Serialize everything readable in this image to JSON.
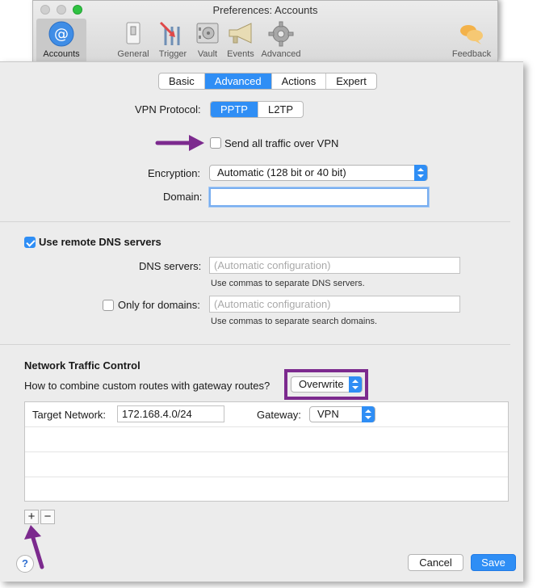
{
  "window": {
    "title": "Preferences: Accounts",
    "toolbar": [
      {
        "label": "Accounts",
        "icon": "at-sign-icon"
      },
      {
        "label": "General",
        "icon": "switch-icon"
      },
      {
        "label": "Trigger",
        "icon": "trigger-icon"
      },
      {
        "label": "Vault",
        "icon": "vault-icon"
      },
      {
        "label": "Events",
        "icon": "megaphone-icon"
      },
      {
        "label": "Advanced",
        "icon": "gear-icon"
      },
      {
        "label": "Feedback",
        "icon": "chat-bubbles-icon"
      }
    ]
  },
  "tabs": [
    "Basic",
    "Advanced",
    "Actions",
    "Expert"
  ],
  "active_tab": "Advanced",
  "vpn": {
    "protocol_label": "VPN Protocol:",
    "protocols": [
      "PPTP",
      "L2TP"
    ],
    "active_protocol": "PPTP",
    "send_all_traffic_label": "Send all traffic over VPN",
    "send_all_traffic_checked": false,
    "encryption_label": "Encryption:",
    "encryption_value": "Automatic (128 bit or 40 bit)",
    "domain_label": "Domain:",
    "domain_value": ""
  },
  "dns": {
    "use_remote_label": "Use remote DNS servers",
    "use_remote_checked": true,
    "servers_label": "DNS servers:",
    "servers_placeholder": "(Automatic configuration)",
    "servers_hint": "Use commas to separate DNS servers.",
    "only_domains_label": "Only for domains:",
    "only_domains_checked": false,
    "domains_placeholder": "(Automatic configuration)",
    "domains_hint": "Use commas to separate search domains."
  },
  "traffic": {
    "heading": "Network Traffic Control",
    "combine_label": "How to combine custom routes with gateway routes?",
    "combine_value": "Overwrite",
    "row": {
      "target_label": "Target Network:",
      "target_value": "172.168.4.0/24",
      "gateway_label": "Gateway:",
      "gateway_value": "VPN"
    }
  },
  "controls": {
    "add": "+",
    "remove": "−",
    "help": "?",
    "cancel": "Cancel",
    "save": "Save"
  },
  "colors": {
    "accent": "#2f8ef5",
    "annotation": "#7c2a8e"
  }
}
